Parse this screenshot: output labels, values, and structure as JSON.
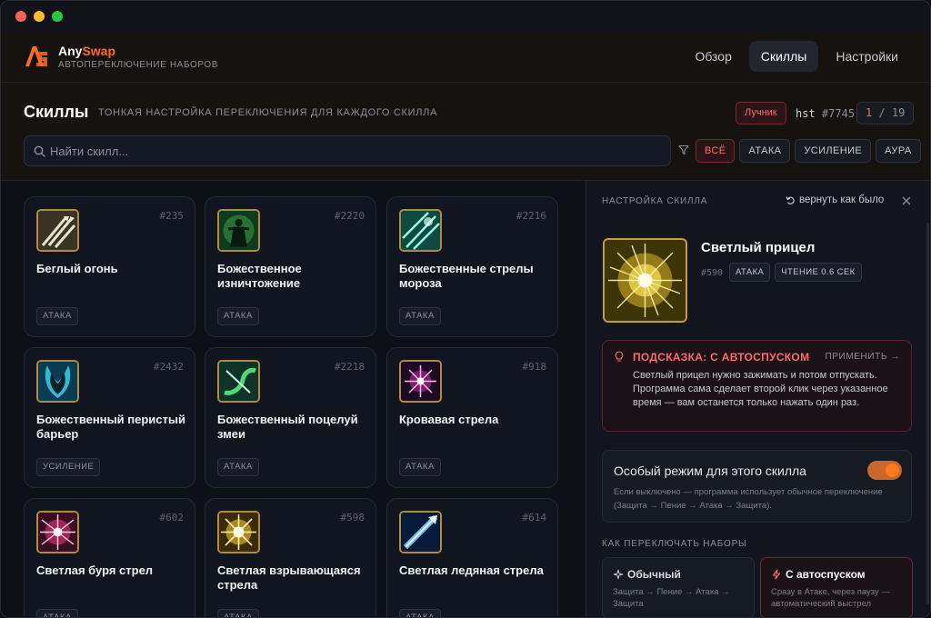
{
  "app": {
    "name_main": "Any",
    "name_accent": "Swap",
    "subtitle": "АВТОПЕРЕКЛЮЧЕНИЕ НАБОРОВ"
  },
  "nav": {
    "items": [
      {
        "label": "Обзор",
        "active": false
      },
      {
        "label": "Скиллы",
        "active": true
      },
      {
        "label": "Настройки",
        "active": false
      }
    ]
  },
  "page": {
    "title": "Скиллы",
    "subtitle": "ТОНКАЯ НАСТРОЙКА ПЕРЕКЛЮЧЕНИЯ ДЛЯ КАЖДОГО СКИЛЛА",
    "class_badge": "Лучник",
    "hst_label": "hst",
    "hst_number": "#7745",
    "pager_current": "1",
    "pager_sep": " / ",
    "pager_total": "19"
  },
  "search": {
    "placeholder": "Найти скилл..."
  },
  "filters": [
    {
      "label": "ВСЁ",
      "active": true
    },
    {
      "label": "АТАКА",
      "active": false
    },
    {
      "label": "УСИЛЕНИЕ",
      "active": false
    },
    {
      "label": "АУРА",
      "active": false
    }
  ],
  "skills": [
    {
      "id": "#235",
      "name": "Беглый огонь",
      "tag": "АТАКА",
      "icon": "triple-arrow-icon"
    },
    {
      "id": "#2220",
      "name": "Божественное изничтожение",
      "tag": "АТАКА",
      "icon": "divine-figure-icon"
    },
    {
      "id": "#2216",
      "name": "Божественные стрелы мороза",
      "tag": "АТАКА",
      "icon": "frost-arrows-icon"
    },
    {
      "id": "#2432",
      "name": "Божественный перистый барьер",
      "tag": "УСИЛЕНИЕ",
      "icon": "feather-barrier-icon"
    },
    {
      "id": "#2218",
      "name": "Божественный поцелуй змеи",
      "tag": "АТАКА",
      "icon": "serpent-kiss-icon"
    },
    {
      "id": "#918",
      "name": "Кровавая стрела",
      "tag": "АТАКА",
      "icon": "blood-arrow-icon"
    },
    {
      "id": "#602",
      "name": "Светлая буря стрел",
      "tag": "АТАКА",
      "icon": "arrow-storm-icon"
    },
    {
      "id": "#598",
      "name": "Светлая взрывающаяся стрела",
      "tag": "АТАКА",
      "icon": "exploding-arrow-icon"
    },
    {
      "id": "#614",
      "name": "Светлая ледяная стрела",
      "tag": "АТАКА",
      "icon": "ice-arrow-icon"
    }
  ],
  "panel": {
    "title": "НАСТРОЙКА СКИЛЛА",
    "reset_label": "вернуть как было",
    "skill": {
      "name": "Светлый прицел",
      "id": "#590",
      "tags": [
        "АТАКА",
        "ЧТЕНИЕ 0.6 СЕК"
      ],
      "icon": "light-aim-icon"
    },
    "hint": {
      "title": "ПОДСКАЗКА: С АВТОСПУСКОМ",
      "apply_label": "ПРИМЕНИТЬ →",
      "text": "Светлый прицел нужно зажимать и потом отпускать. Программа сама сделает второй клик через указанное время — вам останется только нажать один раз."
    },
    "special_mode": {
      "title": "Особый режим для этого скилла",
      "enabled": true,
      "desc": "Если выключено — программа использует обычное переключение (Защита → Пение → Атака → Защита)."
    },
    "switch_section_title": "КАК ПЕРЕКЛЮЧАТЬ НАБОРЫ",
    "modes": [
      {
        "title": "Обычный",
        "desc": "Защита → Пение → Атака → Защита",
        "selected": false
      },
      {
        "title": "С автоспуском",
        "desc": "Сразу в Атаке, через паузу — автоматический выстрел",
        "selected": true
      }
    ]
  },
  "colors": {
    "accent": "#ff6a2b",
    "danger": "#ff6b6b",
    "toggle_on": "#ff7a1a",
    "background": "#0d1017"
  }
}
